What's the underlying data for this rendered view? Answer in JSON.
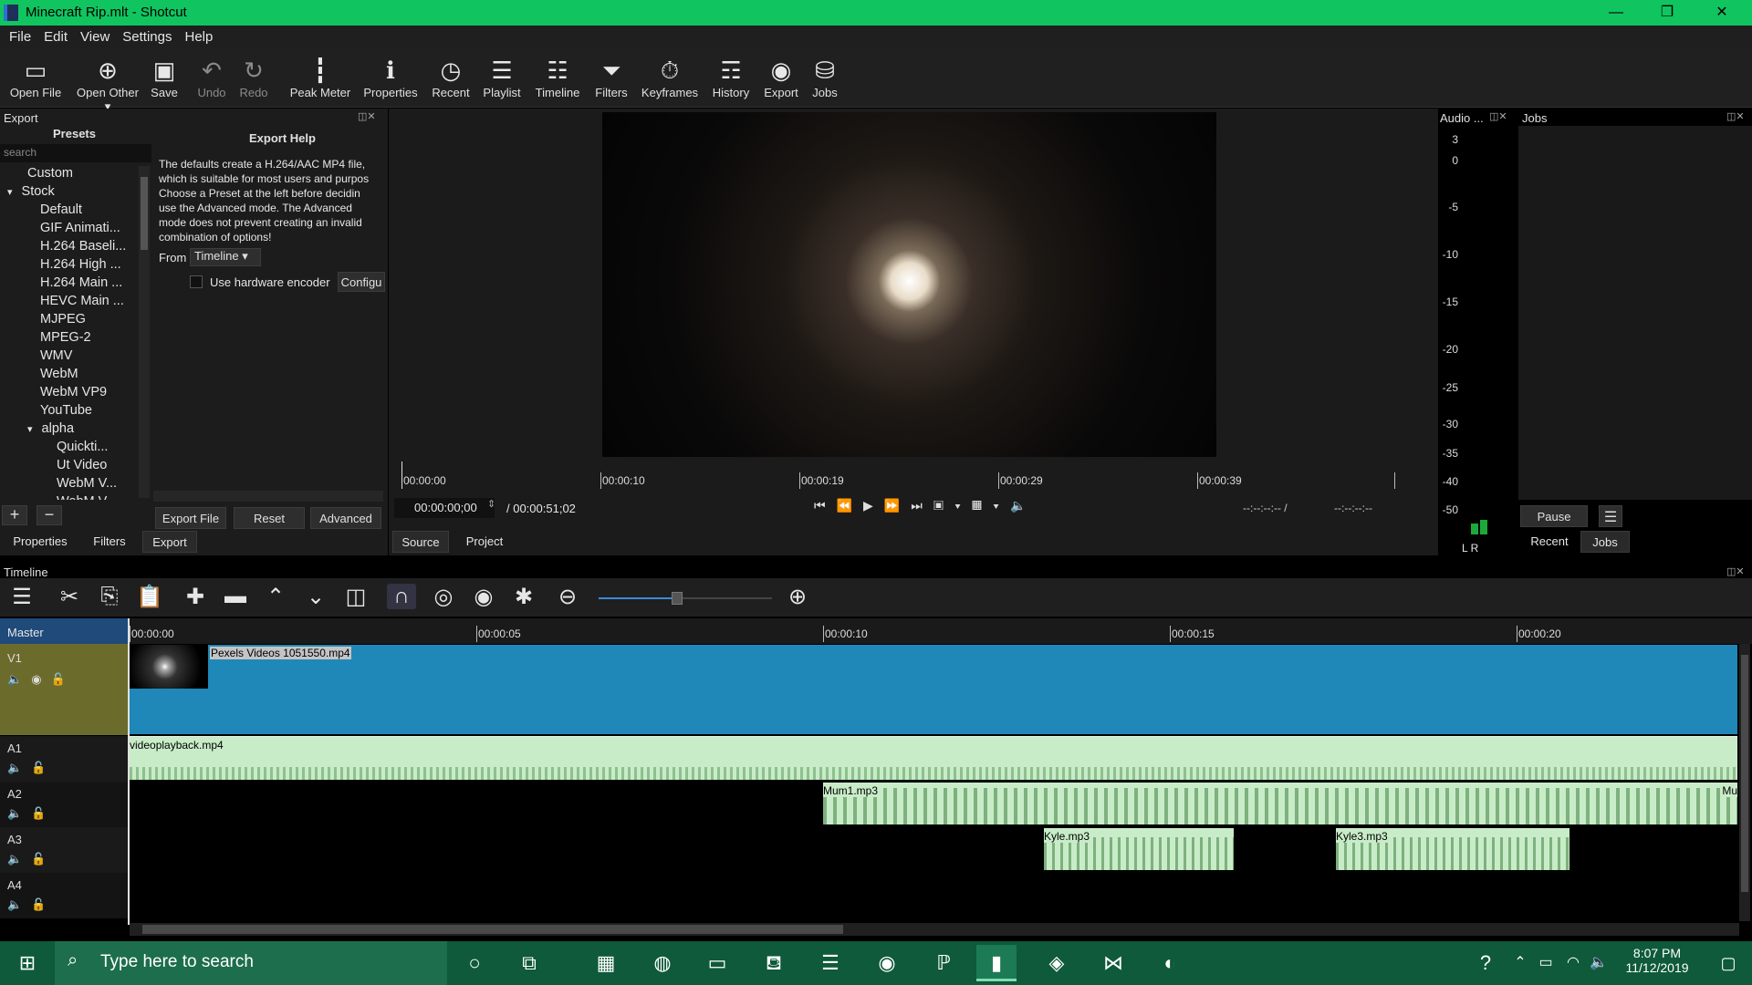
{
  "window": {
    "title": "Minecraft Rip.mlt - Shotcut",
    "minimize": "—",
    "restore": "❐",
    "close": "✕"
  },
  "menu": [
    "File",
    "Edit",
    "View",
    "Settings",
    "Help"
  ],
  "toolbar": [
    {
      "label": "Open File",
      "icon": "folder-open-icon",
      "glyph": "📂"
    },
    {
      "label": "Open Other",
      "icon": "open-other-icon",
      "glyph": "➕"
    },
    {
      "label": "Save",
      "icon": "save-icon",
      "glyph": "💾"
    },
    {
      "label": "Undo",
      "icon": "undo-icon",
      "glyph": "↶"
    },
    {
      "label": "Redo",
      "icon": "redo-icon",
      "glyph": "↷"
    },
    {
      "label": "Peak Meter",
      "icon": "peak-meter-icon",
      "glyph": "┇"
    },
    {
      "label": "Properties",
      "icon": "info-icon",
      "glyph": "ℹ"
    },
    {
      "label": "Recent",
      "icon": "clock-icon",
      "glyph": "◷"
    },
    {
      "label": "Playlist",
      "icon": "playlist-icon",
      "glyph": "☰"
    },
    {
      "label": "Timeline",
      "icon": "timeline-icon",
      "glyph": "☷"
    },
    {
      "label": "Filters",
      "icon": "filter-icon",
      "glyph": "⏷"
    },
    {
      "label": "Keyframes",
      "icon": "stopwatch-icon",
      "glyph": "⏱"
    },
    {
      "label": "History",
      "icon": "history-icon",
      "glyph": "☶"
    },
    {
      "label": "Export",
      "icon": "export-icon",
      "glyph": "◉"
    },
    {
      "label": "Jobs",
      "icon": "jobs-icon",
      "glyph": "⛁"
    }
  ],
  "export_panel": {
    "title": "Export",
    "presets_heading": "Presets",
    "search_placeholder": "search",
    "tree": [
      {
        "label": "Custom",
        "indent": 0
      },
      {
        "label": "Stock",
        "indent": 0,
        "arrow": "▾"
      },
      {
        "label": "Default",
        "indent": 2
      },
      {
        "label": "GIF Animati...",
        "indent": 2
      },
      {
        "label": "H.264 Baseli...",
        "indent": 2
      },
      {
        "label": "H.264 High ...",
        "indent": 2
      },
      {
        "label": "H.264 Main ...",
        "indent": 2
      },
      {
        "label": "HEVC Main ...",
        "indent": 2
      },
      {
        "label": "MJPEG",
        "indent": 2
      },
      {
        "label": "MPEG-2",
        "indent": 2
      },
      {
        "label": "WMV",
        "indent": 2
      },
      {
        "label": "WebM",
        "indent": 2
      },
      {
        "label": "WebM VP9",
        "indent": 2
      },
      {
        "label": "YouTube",
        "indent": 2
      },
      {
        "label": "alpha",
        "indent": 2,
        "arrow": "▾"
      },
      {
        "label": "Quickti...",
        "indent": 3
      },
      {
        "label": "Ut Video",
        "indent": 3
      },
      {
        "label": "WebM V...",
        "indent": 3
      },
      {
        "label": "WebM V...",
        "indent": 3
      }
    ],
    "help_heading": "Export Help",
    "help_lines": [
      "The defaults create a H.264/AAC MP4 file,",
      "which is suitable for most users and purpos",
      "Choose a Preset at the left before decidin",
      "use the Advanced mode. The Advanced",
      "mode does not prevent creating an invalid",
      "combination of options!"
    ],
    "from_label": "From",
    "from_value": "Timeline",
    "hw_encoder_label": "Use hardware encoder",
    "configure_label": "Configu",
    "export_file": "Export File",
    "reset": "Reset",
    "advanced": "Advanced",
    "tabs": [
      "Properties",
      "Filters",
      "Export"
    ]
  },
  "player": {
    "ruler_labels": [
      "00:00:00",
      "00:00:10",
      "00:00:19",
      "00:00:29",
      "00:00:39"
    ],
    "current_time": "00:00:00;00",
    "total_time": "/ 00:00:51;02",
    "in_point": "--:--:--:-- /",
    "out_point": "--:--:--:--",
    "tabs": [
      "Source",
      "Project"
    ]
  },
  "audio_meter": {
    "title": "Audio ...",
    "scale": [
      "3",
      "0",
      "-5",
      "-10",
      "-15",
      "-20",
      "-25",
      "-30",
      "-35",
      "-40",
      "-50"
    ],
    "channels": "L R"
  },
  "jobs_panel": {
    "title": "Jobs",
    "pause": "Pause",
    "tabs": [
      "Recent",
      "Jobs"
    ]
  },
  "timeline": {
    "title": "Timeline",
    "ruler_labels": [
      "00:00:00",
      "00:00:05",
      "00:00:10",
      "00:00:15",
      "00:00:20"
    ],
    "master": "Master",
    "tracks": [
      {
        "name": "V1"
      },
      {
        "name": "A1"
      },
      {
        "name": "A2"
      },
      {
        "name": "A3"
      },
      {
        "name": "A4"
      }
    ],
    "clips": {
      "v1": "Pexels Videos 1051550.mp4",
      "a1": "videoplayback.mp4",
      "a2": "Mum1.mp3",
      "a2b": "Mu",
      "a3a": "Kyle.mp3",
      "a3b": "Kyle3.mp3"
    },
    "zoom_level": 0.45
  },
  "taskbar": {
    "search_placeholder": "Type here to search",
    "time": "8:07 PM",
    "date": "11/12/2019"
  },
  "colors": {
    "titlebar": "#10c560",
    "taskbar": "#0e5a3a",
    "video_clip": "#1f88b8",
    "audio_clip": "#c8ecc8",
    "track_header": "#6b6b2c"
  }
}
